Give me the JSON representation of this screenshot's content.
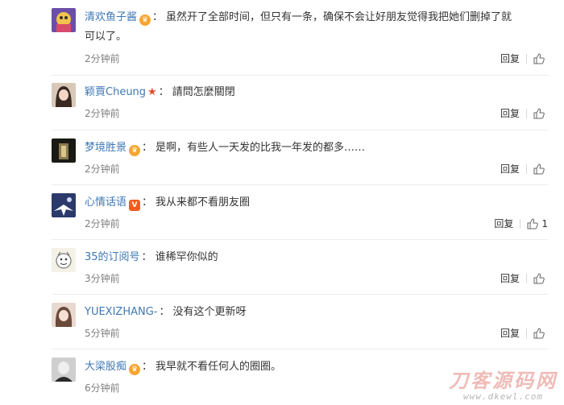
{
  "comments": [
    {
      "username": "清欢鱼子酱",
      "badge": "crown",
      "text_line1": "虽然开了全部时间，但只有一条，确保不会让好朋友觉得我把她们删掉了就",
      "text_line2": "可以了。",
      "time": "2分钟前",
      "reply_label": "回复",
      "like_count": ""
    },
    {
      "username": "颖賈Cheung",
      "badge": "star",
      "text_line1": "請問怎麼關閉",
      "time": "2分钟前",
      "reply_label": "回复",
      "like_count": ""
    },
    {
      "username": "梦境胜景",
      "badge": "crown",
      "text_line1": "是啊，有些人一天发的比我一年发的都多……",
      "time": "2分钟前",
      "reply_label": "回复",
      "like_count": ""
    },
    {
      "username": "心情话语",
      "badge": "vip",
      "text_line1": "我从来都不看朋友圈",
      "time": "2分钟前",
      "reply_label": "回复",
      "like_count": "1"
    },
    {
      "username": "35的订阅号",
      "badge": "",
      "text_line1": "谁稀罕你似的",
      "time": "3分钟前",
      "reply_label": "回复",
      "like_count": ""
    },
    {
      "username": "YUEXIZHANG-",
      "badge": "",
      "text_line1": "没有这个更新呀",
      "time": "5分钟前",
      "reply_label": "回复",
      "like_count": ""
    },
    {
      "username": "大梁股痴",
      "badge": "crown",
      "text_line1": "我早就不看任何人的圈圈。",
      "time": "6分钟前",
      "reply_label": "回复",
      "like_count": ""
    }
  ],
  "colon": "：",
  "watermark": {
    "title": "刀客源码网",
    "url": "www.dkewl.com"
  },
  "colors": {
    "username": "#3f78b4",
    "time": "#808080",
    "divider": "#ececec"
  }
}
